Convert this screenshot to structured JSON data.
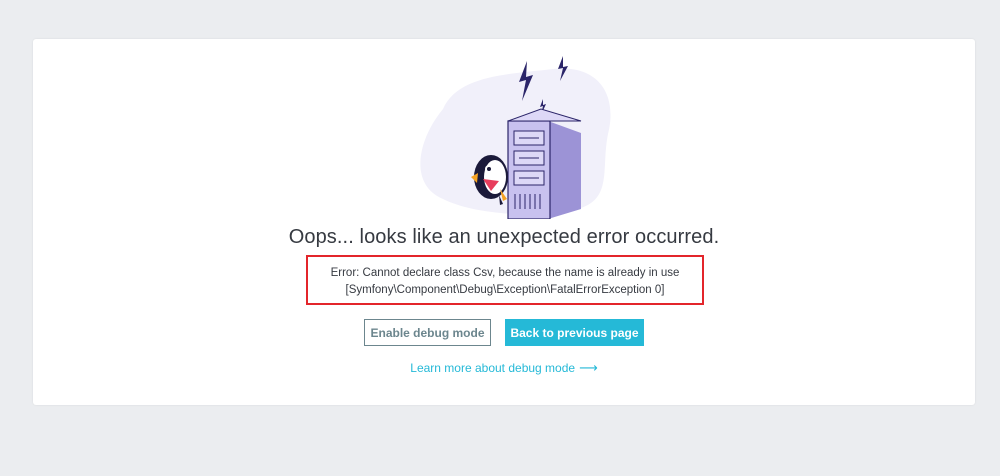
{
  "page": {
    "title": "Oops... looks like an unexpected error occurred.",
    "error_line1": "Error: Cannot declare class Csv, because the name is already in use",
    "error_line2": "[Symfony\\Component\\Debug\\Exception\\FatalErrorException 0]"
  },
  "actions": {
    "debug_label": "Enable debug mode",
    "back_label": "Back to previous page",
    "learn_more_label": "Learn more about debug mode",
    "learn_more_arrow": "⟶"
  },
  "colors": {
    "accent": "#25b9d7",
    "error_border": "#e3252b",
    "text": "#363a41",
    "illustration_bg": "#f1f0fa",
    "server": "#b9b2e6"
  },
  "icons": {
    "illustration": "server-error-puffin-illustration",
    "arrow": "arrow-right-icon"
  }
}
